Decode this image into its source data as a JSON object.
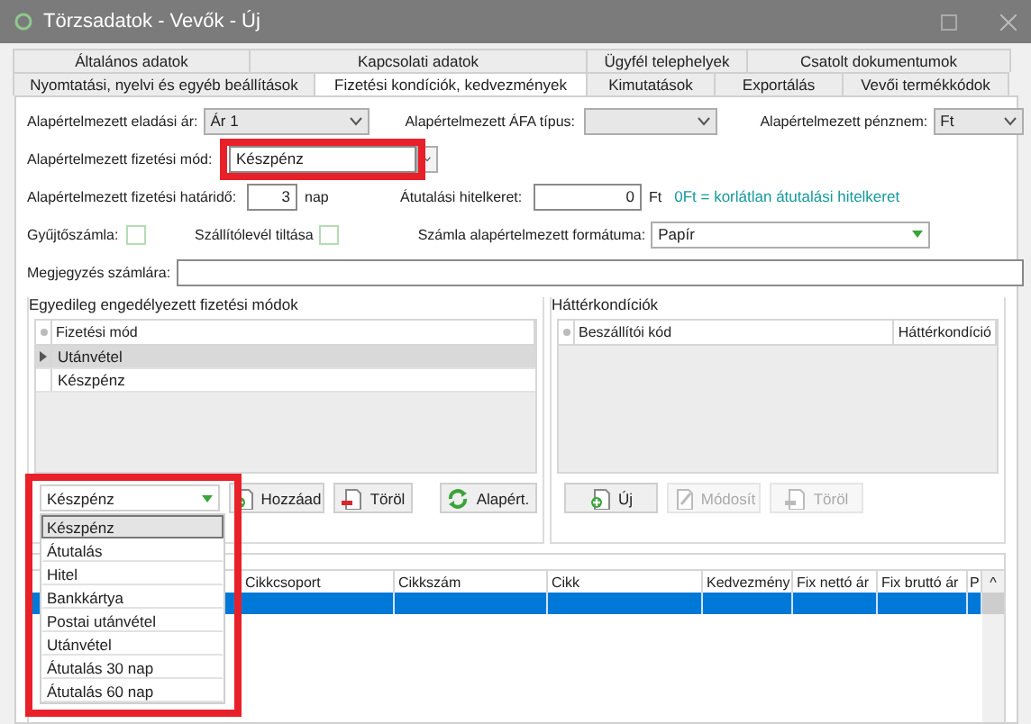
{
  "window": {
    "title": "Törzsadatok - Vevők - Új"
  },
  "tabs": [
    [
      {
        "label": "Általános adatok",
        "selected": false
      },
      {
        "label": "Kapcsolati adatok",
        "selected": false
      },
      {
        "label": "Ügyfél telephelyek",
        "selected": false
      },
      {
        "label": "Csatolt dokumentumok",
        "selected": false
      }
    ],
    [
      {
        "label": "Nyomtatási, nyelvi és egyéb beállítások",
        "selected": false
      },
      {
        "label": "Fizetési kondíciók, kedvezmények",
        "selected": true
      },
      {
        "label": "Kimutatások",
        "selected": false
      },
      {
        "label": "Exportálás",
        "selected": false
      },
      {
        "label": "Vevői termékkódok",
        "selected": false
      }
    ]
  ],
  "defaults": {
    "price_label": "Alapértelmezett eladási ár:",
    "price": "Ár 1",
    "vat_label": "Alapértelmezett ÁFA típus:",
    "currency_label": "Alapértelmezett pénznem:",
    "currency": "Ft",
    "payment_label": "Alapértelmezett fizetési mód:",
    "payment": "Készpénz",
    "deadline_label": "Alapértelmezett fizetési határidő:",
    "deadline": "3",
    "deadline_unit": "nap",
    "credit_label": "Átutalási hitelkeret:",
    "credit": "0",
    "credit_unit": "Ft",
    "credit_hint": "0Ft = korlátlan átutalási hitelkeret"
  },
  "flags": [
    {
      "label": "Gyűjtőszámla:",
      "checked": false
    },
    {
      "label": "Szállítólevél tiltása",
      "checked": false
    }
  ],
  "format": {
    "label": "Számla alapértelmezett formátuma:",
    "value": "Papír"
  },
  "note": {
    "label": "Megjegyzés számlára:"
  },
  "payment_modes": {
    "title": "Egyedileg engedélyezett fizetési módok",
    "column": "Fizetési mód",
    "rows": [
      {
        "label": "Utánvétel",
        "selected": true
      },
      {
        "label": "Készpénz",
        "selected": false
      }
    ],
    "combo": "Készpénz",
    "options": [
      {
        "label": "Készpénz",
        "selected": true
      },
      {
        "label": "Átutalás",
        "selected": false
      },
      {
        "label": "Hitel",
        "selected": false
      },
      {
        "label": "Bankkártya",
        "selected": false
      },
      {
        "label": "Postai utánvétel",
        "selected": false
      },
      {
        "label": "Utánvétel",
        "selected": false
      },
      {
        "label": "Átutalás 30 nap",
        "selected": false
      },
      {
        "label": "Átutalás 60 nap",
        "selected": false
      }
    ],
    "buttons": [
      {
        "label": "Hozzáad",
        "kind": "add",
        "disabled": false
      },
      {
        "label": "Töröl",
        "kind": "delete",
        "disabled": false
      },
      {
        "label": "Alapért.",
        "kind": "reset",
        "disabled": false
      }
    ]
  },
  "background": {
    "title": "Háttérkondíciók",
    "columns": [
      "Beszállítói kód",
      "Háttérkondíció"
    ],
    "buttons": [
      {
        "label": "Új",
        "kind": "add",
        "disabled": false
      },
      {
        "label": "Módosít",
        "kind": "edit",
        "disabled": true
      },
      {
        "label": "Töröl",
        "kind": "delete",
        "disabled": true
      }
    ]
  },
  "discounts": {
    "columns": [
      "Cikkcsoport",
      "Cikkszám",
      "Cikk",
      "Kedvezmény",
      "Fix nettó ár",
      "Fix bruttó ár",
      "P"
    ],
    "scroll_arrow": "^"
  }
}
